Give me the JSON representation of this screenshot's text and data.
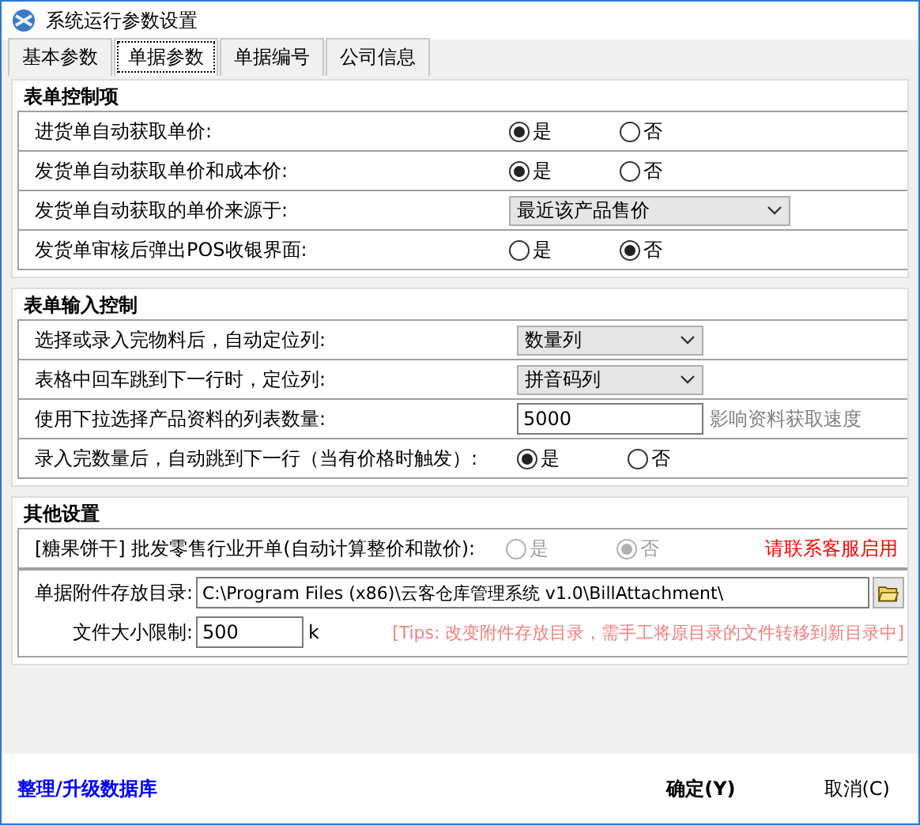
{
  "window": {
    "title": "系统运行参数设置"
  },
  "tabs": [
    {
      "label": "基本参数",
      "selected": false
    },
    {
      "label": "单据参数",
      "selected": true
    },
    {
      "label": "单据编号",
      "selected": false
    },
    {
      "label": "公司信息",
      "selected": false
    }
  ],
  "sections": [
    {
      "title": "表单控制项",
      "rows": [
        {
          "kind": "radio",
          "label": "进货单自动获取单价:",
          "options": [
            {
              "label": "是",
              "selected": true
            },
            {
              "label": "否",
              "selected": false
            }
          ]
        },
        {
          "kind": "radio",
          "label": "发货单自动获取单价和成本价:",
          "options": [
            {
              "label": "是",
              "selected": true
            },
            {
              "label": "否",
              "selected": false
            }
          ]
        },
        {
          "kind": "select",
          "label": "发货单自动获取的单价来源于:",
          "value": "最近该产品售价"
        },
        {
          "kind": "radio",
          "label": "发货单审核后弹出POS收银界面:",
          "options": [
            {
              "label": "是",
              "selected": false
            },
            {
              "label": "否",
              "selected": true
            }
          ]
        }
      ]
    },
    {
      "title": "表单输入控制",
      "rows": [
        {
          "kind": "select",
          "label": "选择或录入完物料后，自动定位列:",
          "value": "数量列"
        },
        {
          "kind": "select",
          "label": "表格中回车跳到下一行时，定位列:",
          "value": "拼音码列"
        },
        {
          "kind": "input",
          "label": "使用下拉选择产品资料的列表数量:",
          "value": "5000",
          "hint": "影响资料获取速度"
        },
        {
          "kind": "radio",
          "label": "录入完数量后，自动跳到下一行（当有价格时触发）:",
          "options": [
            {
              "label": "是",
              "selected": true
            },
            {
              "label": "否",
              "selected": false
            }
          ]
        }
      ]
    }
  ],
  "other": {
    "title": "其他设置",
    "wholesale": {
      "label": "[糖果饼干] 批发零售行业开单(自动计算整价和散价):",
      "disabled": true,
      "options": [
        {
          "label": "是",
          "selected": false
        },
        {
          "label": "否",
          "selected": true
        }
      ],
      "notice": "请联系客服启用"
    },
    "attachment_dir": {
      "label": "单据附件存放目录:",
      "value": "C:\\Program Files (x86)\\云客仓库管理系统 v1.0\\BillAttachment\\"
    },
    "size_limit": {
      "label": "文件大小限制:",
      "value": "500",
      "unit": "k",
      "tip": "[Tips: 改变附件存放目录，需手工将原目录的文件转移到新目录中]"
    }
  },
  "footer": {
    "link": "整理/升级数据库",
    "buttons": [
      {
        "label": "确定(Y)",
        "kind": "primary"
      },
      {
        "label": "取消(C)",
        "kind": "normal"
      }
    ]
  }
}
